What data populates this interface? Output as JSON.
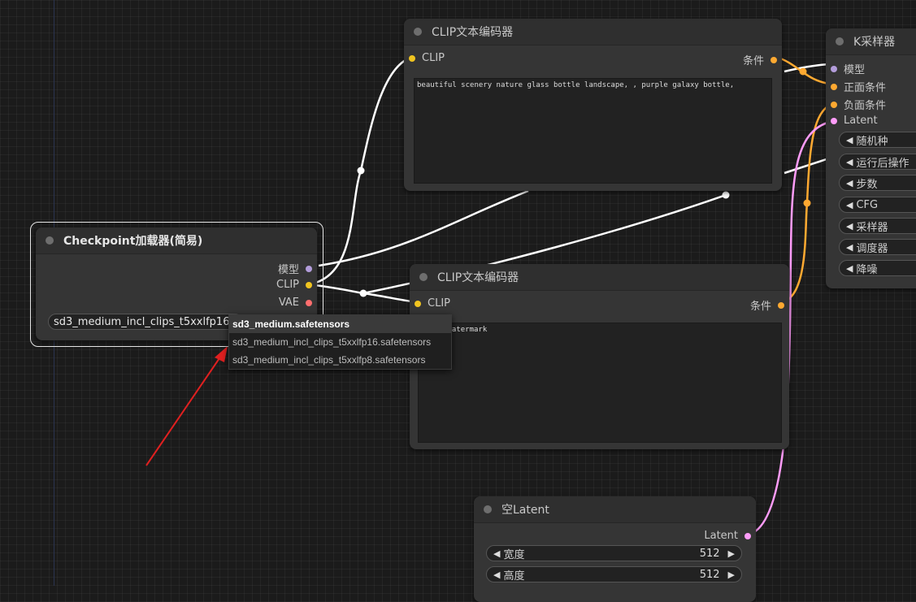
{
  "colors": {
    "clip": "#f0c420",
    "model": "#b39ddb",
    "vae": "#ff6e6e",
    "conditioning": "#ffa931",
    "latent": "#ff9cf9",
    "link_white": "#ffffff",
    "annotation_arrow": "#e02020"
  },
  "clip_top": {
    "title": "CLIP文本编码器",
    "input_clip": "CLIP",
    "output_cond": "条件",
    "text": "beautiful scenery nature glass bottle landscape, , purple galaxy bottle,"
  },
  "clip_bottom": {
    "title": "CLIP文本编码器",
    "input_clip": "CLIP",
    "output_cond": "条件",
    "text": "text, watermark"
  },
  "checkpoint": {
    "title": "Checkpoint加载器(简易)",
    "out_model": "模型",
    "out_clip": "CLIP",
    "out_vae": "VAE",
    "ckpt_value": "sd3_medium_incl_clips_t5xxlfp16.safetensors"
  },
  "dropdown": {
    "options": [
      "sd3_medium.safetensors",
      "sd3_medium_incl_clips_t5xxlfp16.safetensors",
      "sd3_medium_incl_clips_t5xxlfp8.safetensors"
    ]
  },
  "ksampler": {
    "title": "K采样器",
    "in_model": "模型",
    "in_positive": "正面条件",
    "in_negative": "负面条件",
    "in_latent": "Latent",
    "widgets": [
      "随机种",
      "运行后操作",
      "步数",
      "CFG",
      "采样器",
      "调度器",
      "降噪"
    ]
  },
  "empty_latent": {
    "title": "空Latent",
    "out_latent": "Latent",
    "width_label": "宽度",
    "width_value": "512",
    "height_label": "高度",
    "height_value": "512"
  }
}
